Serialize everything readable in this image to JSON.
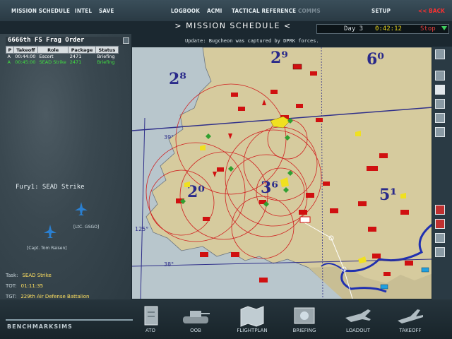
{
  "menu": {
    "mission_schedule": "MISSION SCHEDULE",
    "intel": "INTEL",
    "save": "SAVE",
    "logbook": "LOGBOOK",
    "acmi": "ACMI",
    "tactical_reference": "TACTICAL REFERENCE",
    "comms": "COMMS",
    "setup": "SETUP",
    "back": "<< BACK"
  },
  "title": "> MISSION SCHEDULE <",
  "clock": {
    "day": "Day  3",
    "time": "0:42:12",
    "stop": "Stop"
  },
  "ticker": "Update: Bugcheon was captured by DPRK forces.",
  "frag": {
    "title": "6666th FS Frag Order",
    "columns": [
      "P",
      "Takeoff",
      "Role",
      "Package",
      "Status"
    ],
    "rows": [
      [
        "A",
        "00:44:00",
        "Escort",
        "2471",
        "Briefing"
      ],
      [
        "A",
        "00:45:00",
        "SEAD Strike",
        "2471",
        "Briefing"
      ]
    ]
  },
  "flight": {
    "name": "Fury1: SEAD Strike",
    "pilot1": "[LtC. GSGO]",
    "pilot2": "[Capt. Tom Raisen]",
    "task_label": "Task:",
    "task_value": "SEAD Strike",
    "tot_label": "TOT:",
    "tot_value": "01:11:35",
    "tgt_label": "TGT:",
    "tgt_value": "229th Air Defense Battalion"
  },
  "map": {
    "grid_labels": [
      "2⁸",
      "2⁹",
      "6⁰",
      "2⁰",
      "3⁶",
      "5¹"
    ],
    "lat_labels": [
      "39°",
      "38°",
      "125°"
    ]
  },
  "bottom": {
    "logo": "BENCHMARKSIMS",
    "ato": "ATO",
    "oob": "OOB",
    "flightplan": "FLIGHTPLAN",
    "briefing": "BRIEFING",
    "loadout": "LOADOUT",
    "takeoff": "TAKEOFF"
  },
  "colors": {
    "accent_red": "#ff3030",
    "clock_time": "#e6d21a",
    "highlight_green": "#40e040"
  }
}
